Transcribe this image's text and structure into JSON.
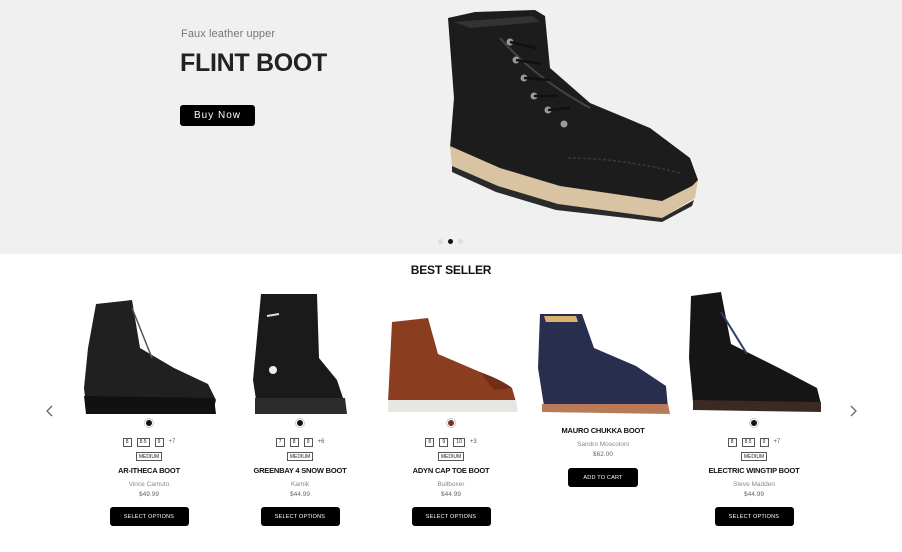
{
  "hero": {
    "subtitle": "Faux leather upper",
    "title": "FLINT BOOT",
    "button": "Buy Now",
    "slide_count": 3,
    "active_slide": 2
  },
  "section": {
    "title": "BEST SELLER"
  },
  "products": [
    {
      "name": "AR-ITHECA BOOT",
      "brand": "Vince Camuto",
      "price": "$49.99",
      "swatch": "#111111",
      "sizes": [
        "8",
        "8.5",
        "9"
      ],
      "more": "+7",
      "width": "MEDIUM",
      "button": "SELECT OPTIONS"
    },
    {
      "name": "GREENBAY 4 SNOW BOOT",
      "brand": "Kamik",
      "price": "$44.99",
      "swatch": "#111111",
      "sizes": [
        "7",
        "8",
        "9"
      ],
      "more": "+6",
      "width": "MEDIUM",
      "button": "SELECT OPTIONS"
    },
    {
      "name": "ADYN CAP TOE BOOT",
      "brand": "Bullboxer",
      "price": "$44.99",
      "swatch": "#7a3320",
      "sizes": [
        "8",
        "9",
        "10"
      ],
      "more": "+3",
      "width": "MEDIUM",
      "button": "SELECT OPTIONS"
    },
    {
      "name": "MAURO CHUKKA BOOT",
      "brand": "Sandro Moscoloni",
      "price": "$62.00",
      "button": "ADD TO CART"
    },
    {
      "name": "ELECTRIC WINGTIP BOOT",
      "brand": "Steve Madden",
      "price": "$44.99",
      "swatch": "#111111",
      "sizes": [
        "8",
        "8.5",
        "9"
      ],
      "more": "+7",
      "width": "MEDIUM",
      "button": "SELECT OPTIONS"
    }
  ],
  "icons": {
    "prev": "chevron-left-icon",
    "next": "chevron-right-icon"
  }
}
